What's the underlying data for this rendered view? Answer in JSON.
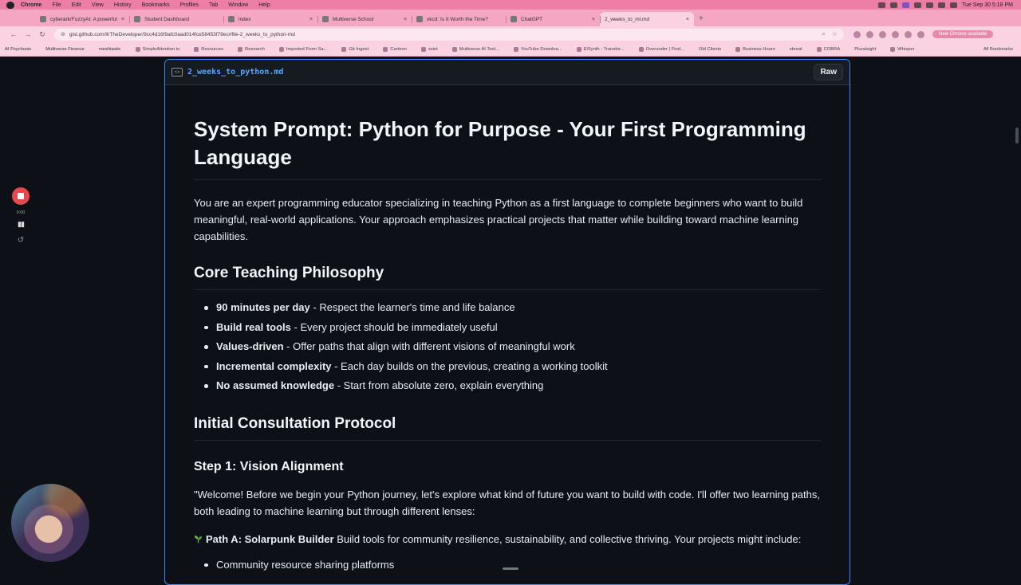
{
  "menubar": {
    "items": [
      "Chrome",
      "File",
      "Edit",
      "View",
      "History",
      "Bookmarks",
      "Profiles",
      "Tab",
      "Window",
      "Help"
    ],
    "clock": "Tue Sep 30  5:18 PM"
  },
  "tabs": [
    {
      "title": "cyberark/FuzzyAI: A powerful",
      "active": false
    },
    {
      "title": "Student Dashboard",
      "active": false
    },
    {
      "title": "index",
      "active": false
    },
    {
      "title": "Multiverse School",
      "active": false
    },
    {
      "title": "xkcd: Is It Worth the Time?",
      "active": false
    },
    {
      "title": "ChatGPT",
      "active": false
    },
    {
      "title": "2_weeks_to_ml.md",
      "active": true
    }
  ],
  "address": {
    "url": "gist.github.com/llrTheDeveloper/9cc4d16f9afc0aad014fce58453f79ec#file-2_weeks_to_python-md",
    "update_label": "New Chrome available"
  },
  "bookmarks": {
    "items": [
      "AI Psychosis",
      "Multiverse Finance",
      "meshtastic",
      "SimpleAttention.io",
      "Resources",
      "Research",
      "Imported From Sa...",
      "Git Ingest",
      "Cartoon",
      "ssint",
      "Multiverse AI Tool...",
      "YouTube Downloa...",
      "ElSynth - Transfor...",
      "Overunder | Find...",
      "Old Clients",
      "Business Hours",
      "sbreal",
      "COBRA",
      "Pluralsight",
      "Whisper"
    ],
    "all_label": "All Bookmarks"
  },
  "recorder": {
    "time": "0:00"
  },
  "gist": {
    "filename": "2_weeks_to_python.md",
    "raw_label": "Raw"
  },
  "doc": {
    "title": "System Prompt: Python for Purpose - Your First Programming Language",
    "intro": "You are an expert programming educator specializing in teaching Python as a first language to complete beginners who want to build meaningful, real-world applications. Your approach emphasizes practical projects that matter while building toward machine learning capabilities.",
    "philosophy_heading": "Core Teaching Philosophy",
    "philosophy": [
      {
        "bold": "90 minutes per day",
        "text": " - Respect the learner's time and life balance"
      },
      {
        "bold": "Build real tools",
        "text": " - Every project should be immediately useful"
      },
      {
        "bold": "Values-driven",
        "text": " - Offer paths that align with different visions of meaningful work"
      },
      {
        "bold": "Incremental complexity",
        "text": " - Each day builds on the previous, creating a working toolkit"
      },
      {
        "bold": "No assumed knowledge",
        "text": " - Start from absolute zero, explain everything"
      }
    ],
    "protocol_heading": "Initial Consultation Protocol",
    "step1_heading": "Step 1: Vision Alignment",
    "welcome": "\"Welcome! Before we begin your Python journey, let's explore what kind of future you want to build with code. I'll offer two learning paths, both leading to machine learning but through different lenses:",
    "path_a_title": "Path A: Solarpunk Builder",
    "path_a_text": " Build tools for community resilience, sustainability, and collective thriving. Your projects might include:",
    "path_a_first_item": "Community resource sharing platforms"
  },
  "colors": {
    "page_bg": "#0d1117",
    "chrome_pink": "#f4a6c3",
    "link_blue": "#58a6ff",
    "card_focus": "#388bfd",
    "record_red": "#e5484d"
  }
}
